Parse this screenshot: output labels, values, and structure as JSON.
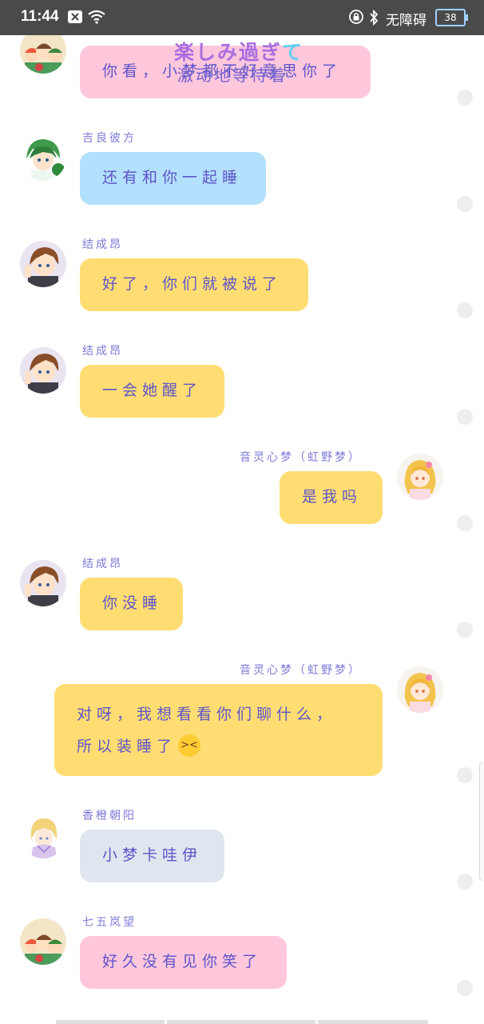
{
  "status_bar": {
    "time": "11:44",
    "accessibility_label": "无障碍",
    "battery": "38",
    "icons": [
      "close-box-icon",
      "wifi-icon",
      "lock-icon",
      "bluetooth-icon",
      "battery-icon"
    ]
  },
  "sticker": {
    "line1_main": "楽しみ過ぎ",
    "line1_end": "て",
    "line2": "激动地等待着"
  },
  "messages": [
    {
      "sender": "",
      "text": "你看，小梦都不好意思你了",
      "color": "#ffc7dc"
    },
    {
      "sender": "吉良彼方",
      "text": "还有和你一起睡",
      "color": "#b3e0fc"
    },
    {
      "sender": "结成昂",
      "text": "好了，你们就被说了",
      "color": "#ffdd72"
    },
    {
      "sender": "结成昂",
      "text": "一会她醒了",
      "color": "#ffdd72"
    },
    {
      "sender": "音灵心梦（虹野梦）",
      "text": "是我吗",
      "color": "#ffdd72"
    },
    {
      "sender": "结成昂",
      "text": "你没睡",
      "color": "#ffdd72"
    },
    {
      "sender": "音灵心梦（虹野梦）",
      "text_line1": "对呀，我想看看你们聊什么，",
      "text_line2": "所以装睡了",
      "emoji": "grinning-squinting-face-emoji",
      "color": "#ffdd72"
    },
    {
      "sender": "香橙朝阳",
      "text": "小梦卡哇伊",
      "color": "#dfe6ef"
    },
    {
      "sender": "七五岚望",
      "text": "好久没有见你笑了",
      "color": "#ffc7dc"
    }
  ],
  "colors": {
    "sender_name": "#7d7ad8",
    "bubble_text": "#5d55c9",
    "status_bar": "#4a4a4a"
  }
}
